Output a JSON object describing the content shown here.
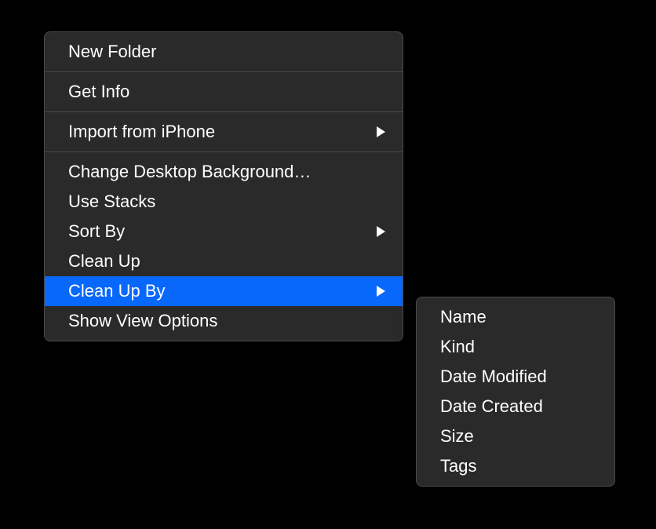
{
  "mainMenu": {
    "items": [
      {
        "label": "New Folder",
        "hasSubmenu": false
      },
      {
        "separator": true
      },
      {
        "label": "Get Info",
        "hasSubmenu": false
      },
      {
        "separator": true
      },
      {
        "label": "Import from iPhone",
        "hasSubmenu": true
      },
      {
        "separator": true
      },
      {
        "label": "Change Desktop Background…",
        "hasSubmenu": false
      },
      {
        "label": "Use Stacks",
        "hasSubmenu": false
      },
      {
        "label": "Sort By",
        "hasSubmenu": true
      },
      {
        "label": "Clean Up",
        "hasSubmenu": false
      },
      {
        "label": "Clean Up By",
        "hasSubmenu": true,
        "selected": true
      },
      {
        "label": "Show View Options",
        "hasSubmenu": false
      }
    ]
  },
  "subMenu": {
    "items": [
      {
        "label": "Name"
      },
      {
        "label": "Kind"
      },
      {
        "label": "Date Modified"
      },
      {
        "label": "Date Created"
      },
      {
        "label": "Size"
      },
      {
        "label": "Tags"
      }
    ]
  }
}
